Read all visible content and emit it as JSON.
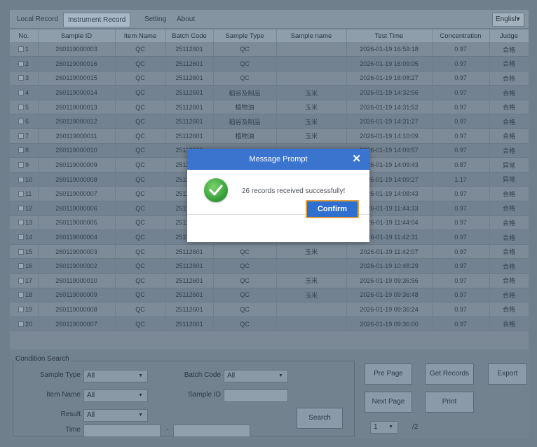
{
  "tabs": [
    {
      "label": "Local Record"
    },
    {
      "label": "Instrument Record"
    },
    {
      "label": "Setting"
    },
    {
      "label": "About"
    }
  ],
  "language": "English",
  "table": {
    "columns": [
      "No.",
      "Sample ID",
      "Item Name",
      "Batch Code",
      "Sample Type",
      "Sample name",
      "Test Time",
      "Concentration",
      "Judge"
    ],
    "rows": [
      [
        "1",
        "260119000003",
        "QC",
        "25112601",
        "QC",
        "",
        "2026-01-19 16:59:18",
        "0.97",
        "合格"
      ],
      [
        "2",
        "260119000016",
        "QC",
        "25112601",
        "QC",
        "",
        "2026-01-19 16:09:05",
        "0.97",
        "合格"
      ],
      [
        "3",
        "260119000015",
        "QC",
        "25112601",
        "QC",
        "",
        "2026-01-19 16:08:27",
        "0.97",
        "合格"
      ],
      [
        "4",
        "260119000014",
        "QC",
        "25112601",
        "稻谷及制品",
        "玉米",
        "2026-01-19 14:32:56",
        "0.97",
        "合格"
      ],
      [
        "5",
        "260119000013",
        "QC",
        "25112601",
        "植物油",
        "玉米",
        "2026-01-19 14:31:52",
        "0.97",
        "合格"
      ],
      [
        "6",
        "260119000012",
        "QC",
        "25112601",
        "稻谷及制品",
        "玉米",
        "2026-01-19 14:31:27",
        "0.97",
        "合格"
      ],
      [
        "7",
        "260119000011",
        "QC",
        "25112601",
        "植物油",
        "玉米",
        "2026-01-19 14:10:09",
        "0.97",
        "合格"
      ],
      [
        "8",
        "260119000010",
        "QC",
        "25112601",
        "",
        "",
        "2026-01-19 14:09:57",
        "0.97",
        "合格"
      ],
      [
        "9",
        "260119000009",
        "QC",
        "25112601",
        "",
        "",
        "2026-01-19 14:09:43",
        "0.87",
        "异常"
      ],
      [
        "10",
        "260119000008",
        "QC",
        "25112601",
        "",
        "",
        "2026-01-19 14:09:27",
        "1.17",
        "异常"
      ],
      [
        "11",
        "260119000007",
        "QC",
        "25112601",
        "",
        "",
        "2026-01-19 14:08:43",
        "0.97",
        "合格"
      ],
      [
        "12",
        "260119000006",
        "QC",
        "25112601",
        "",
        "",
        "2026-01-19 11:44:33",
        "0.97",
        "合格"
      ],
      [
        "13",
        "260119000005",
        "QC",
        "25112601",
        "",
        "",
        "2026-01-19 11:44:04",
        "0.97",
        "合格"
      ],
      [
        "14",
        "260119000004",
        "QC",
        "25112601",
        "QC",
        "玉米",
        "2026-01-19 11:42:31",
        "0.97",
        "合格"
      ],
      [
        "15",
        "260119000003",
        "QC",
        "25112601",
        "QC",
        "玉米",
        "2026-01-19 11:42:07",
        "0.97",
        "合格"
      ],
      [
        "16",
        "260119000002",
        "QC",
        "25112601",
        "QC",
        "",
        "2026-01-19 10:48:29",
        "0.97",
        "合格"
      ],
      [
        "17",
        "260119000010",
        "QC",
        "25112601",
        "QC",
        "玉米",
        "2026-01-19 09:36:56",
        "0.97",
        "合格"
      ],
      [
        "18",
        "260119000009",
        "QC",
        "25112601",
        "QC",
        "玉米",
        "2026-01-19 09:36:48",
        "0.97",
        "合格"
      ],
      [
        "19",
        "260119000008",
        "QC",
        "25112601",
        "QC",
        "",
        "2026-01-19 09:36:24",
        "0.97",
        "合格"
      ],
      [
        "20",
        "260119000007",
        "QC",
        "25112601",
        "QC",
        "",
        "2026-01-19 09:36:00",
        "0.97",
        "合格"
      ]
    ]
  },
  "search": {
    "legend": "Condition Search",
    "sample_type_label": "Sample Type",
    "sample_type_value": "All",
    "batch_code_label": "Batch Code",
    "batch_code_value": "All",
    "item_name_label": "Item Name",
    "item_name_value": "All",
    "sample_id_label": "Sample ID",
    "result_label": "Result",
    "result_value": "All",
    "time_label": "Time",
    "time_separator": "-",
    "search_button": "Search"
  },
  "actions": {
    "pre_page": "Pre Page",
    "get_records": "Get Records",
    "export": "Export",
    "next_page": "Next Page",
    "print": "Print"
  },
  "pagination": {
    "current_page": "1",
    "total_pages": "/2"
  },
  "modal": {
    "title": "Message Prompt",
    "message": "26 records received successfully!",
    "confirm": "Confirm"
  }
}
